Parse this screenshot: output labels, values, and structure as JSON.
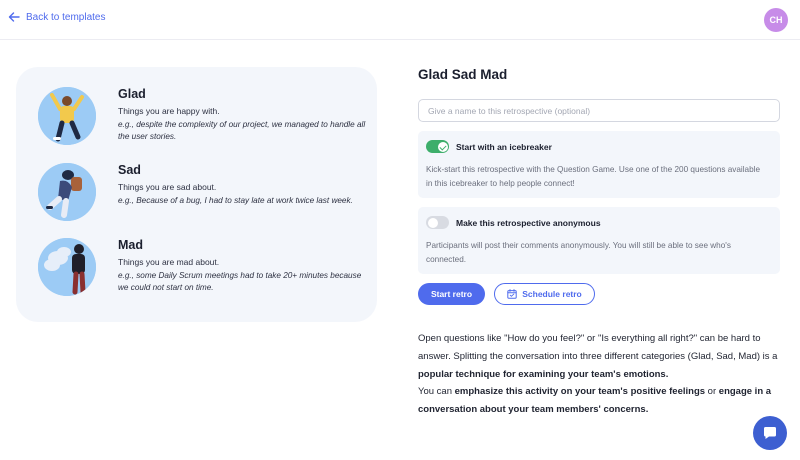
{
  "header": {
    "back_label": "Back to templates",
    "avatar_initials": "CH",
    "avatar_color": "#c78ce8"
  },
  "emotions": [
    {
      "title": "Glad",
      "description": "Things you are happy with.",
      "example": "e.g., despite the complexity of our project, we managed to handle all the user stories.",
      "icon": "glad-person-illustration"
    },
    {
      "title": "Sad",
      "description": "Things you are sad about.",
      "example": "e.g., Because of a bug, I had to stay late at work twice last week.",
      "icon": "sad-person-illustration"
    },
    {
      "title": "Mad",
      "description": "Things you are mad about.",
      "example": "e.g., some Daily Scrum meetings had to take 20+ minutes because we could not start on time.",
      "icon": "mad-person-illustration"
    }
  ],
  "main": {
    "title": "Glad Sad Mad",
    "name_input": {
      "value": "",
      "placeholder": "Give a name to this retrospective (optional)"
    },
    "options": [
      {
        "label": "Start with an icebreaker",
        "enabled": true,
        "text": "Kick-start this retrospective with the Question Game. Use one of the 200 questions available in this icebreaker to help people connect!"
      },
      {
        "label": "Make this retrospective anonymous",
        "enabled": false,
        "text": "Participants will post their comments anonymously. You will still be able to see who's connected."
      }
    ],
    "start_button": "Start retro",
    "schedule_button": "Schedule retro",
    "article": {
      "p1_a": "Open questions like \"How do you feel?\" or \"Is everything all right?\" can be hard to answer. Splitting the conversation into three different categories (Glad, Sad, Mad) is a ",
      "p1_b": "popular technique for examining your team's emotions.",
      "p2_a": "You can ",
      "p2_b": "emphasize this activity on your team's positive feelings",
      "p2_c": " or ",
      "p2_d": "engage in a conversation about your team members' concerns."
    }
  },
  "colors": {
    "accent": "#4f6bed",
    "toggle_on": "#3dae6b",
    "card_bg": "#f3f6fb",
    "illustration_bg": "#9ccbf5"
  }
}
